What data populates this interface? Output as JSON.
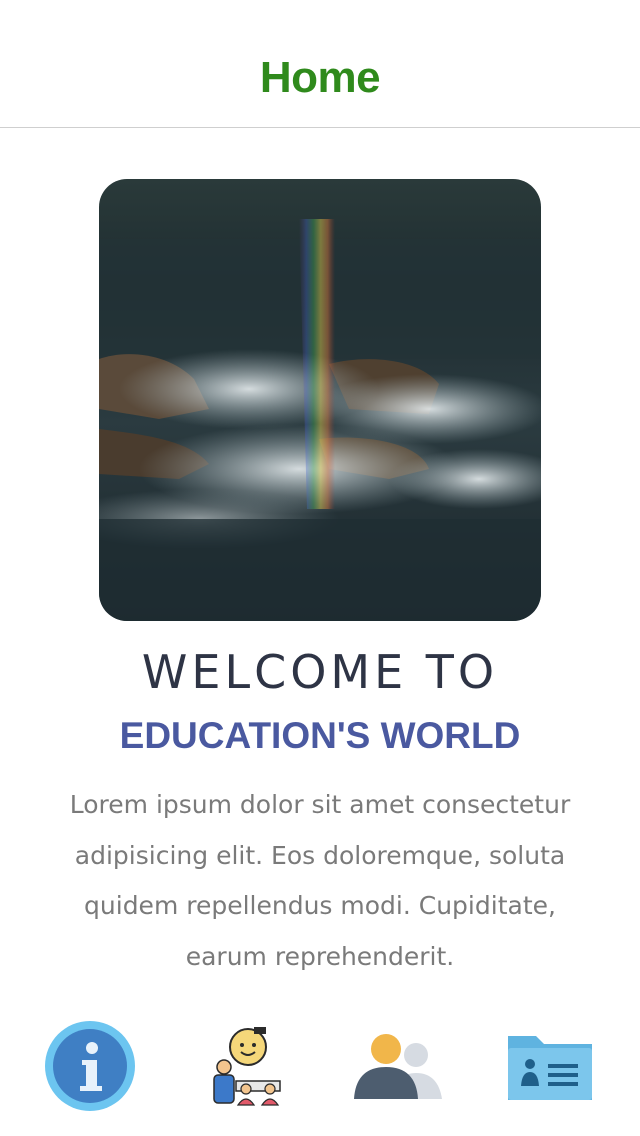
{
  "header": {
    "title": "Home"
  },
  "hero": {
    "image_icon": "ocean-rainbow-photo"
  },
  "content": {
    "welcome": "WELCOME TO",
    "title": "EDUCATION'S WORLD",
    "description": "Lorem ipsum dolor sit amet consectetur adipisicing elit. Eos doloremque, soluta quidem repellendus modi. Cupiditate, earum reprehenderit."
  },
  "bottom_nav": {
    "items": [
      {
        "icon": "info-icon"
      },
      {
        "icon": "classroom-icon"
      },
      {
        "icon": "users-icon"
      },
      {
        "icon": "contact-card-icon"
      }
    ]
  },
  "colors": {
    "header_title": "#2f8a1c",
    "welcome": "#2e3445",
    "subtitle": "#4a59a0",
    "body_text": "#7a7a7a"
  }
}
